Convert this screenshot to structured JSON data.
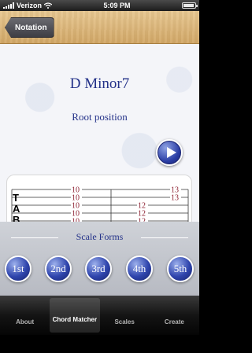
{
  "status_bar": {
    "carrier": "Verizon",
    "time": "5:09 PM"
  },
  "nav": {
    "back_label": "Notation"
  },
  "chord": {
    "name": "D Minor7",
    "position": "Root position"
  },
  "tab": {
    "clef": [
      "T",
      "A",
      "B"
    ],
    "columns": [
      [
        "10",
        "",
        "",
        "13"
      ],
      [
        "10",
        "",
        "",
        "13"
      ],
      [
        "10",
        "",
        "12",
        ""
      ],
      [
        "10",
        "",
        "12",
        ""
      ],
      [
        "10",
        "",
        "12",
        ""
      ],
      [
        "10",
        "",
        "",
        "13"
      ]
    ]
  },
  "scale_forms": {
    "title": "Scale Forms",
    "buttons": [
      "1st",
      "2nd",
      "3rd",
      "4th",
      "5th"
    ]
  },
  "tab_bar": {
    "items": [
      "About",
      "Chord Matcher",
      "Scales",
      "Create"
    ],
    "active_index": 1
  },
  "colors": {
    "title_blue": "#243289",
    "tab_number": "#8a1b2c",
    "button_blue": "#2f45ad"
  }
}
